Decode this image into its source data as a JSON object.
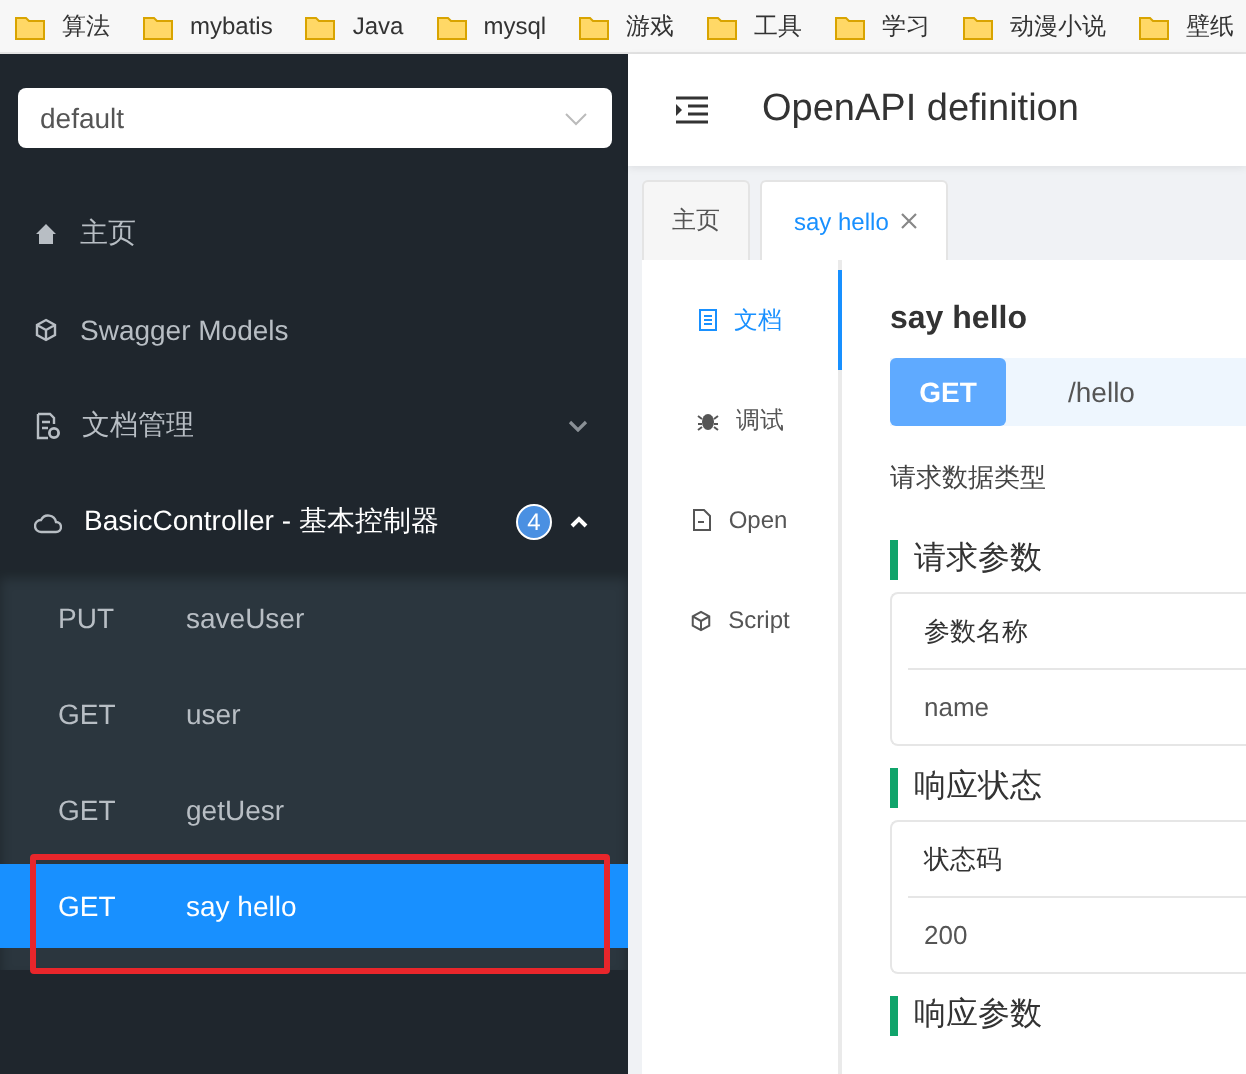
{
  "bookmarks": [
    {
      "label": "算法"
    },
    {
      "label": "mybatis"
    },
    {
      "label": "Java"
    },
    {
      "label": "mysql"
    },
    {
      "label": "游戏"
    },
    {
      "label": "工具"
    },
    {
      "label": "学习"
    },
    {
      "label": "动漫小说"
    },
    {
      "label": "壁纸"
    }
  ],
  "sidebar": {
    "group_select": {
      "value": "default"
    },
    "menu": [
      {
        "kind": "home",
        "label": "主页"
      },
      {
        "kind": "models",
        "label": "Swagger Models"
      },
      {
        "kind": "docs",
        "label": "文档管理",
        "expanded": false
      },
      {
        "kind": "controller",
        "label": "BasicController - 基本控制器",
        "badge": "4",
        "expanded": true,
        "children": [
          {
            "method": "PUT",
            "name": "saveUser",
            "selected": false
          },
          {
            "method": "GET",
            "name": "user",
            "selected": false
          },
          {
            "method": "GET",
            "name": "getUesr",
            "selected": false
          },
          {
            "method": "GET",
            "name": "say hello",
            "selected": true,
            "highlighted": true
          }
        ]
      }
    ]
  },
  "header": {
    "title": "OpenAPI definition"
  },
  "tabs": [
    {
      "label": "主页",
      "selected": false,
      "closable": false
    },
    {
      "label": "say hello",
      "selected": true,
      "closable": true
    }
  ],
  "side_tabs": [
    {
      "kind": "doc",
      "label": "文档",
      "selected": true
    },
    {
      "kind": "debug",
      "label": "调试",
      "selected": false
    },
    {
      "kind": "open",
      "label": "Open",
      "selected": false
    },
    {
      "kind": "script",
      "label": "Script",
      "selected": false
    }
  ],
  "doc": {
    "title": "say hello",
    "method": "GET",
    "path": "/hello",
    "content_type_label": "请求数据类型",
    "sections": [
      {
        "title": "请求参数",
        "header": "参数名称",
        "value": "name"
      },
      {
        "title": "响应状态",
        "header": "状态码",
        "value": "200"
      },
      {
        "title": "响应参数"
      }
    ]
  }
}
